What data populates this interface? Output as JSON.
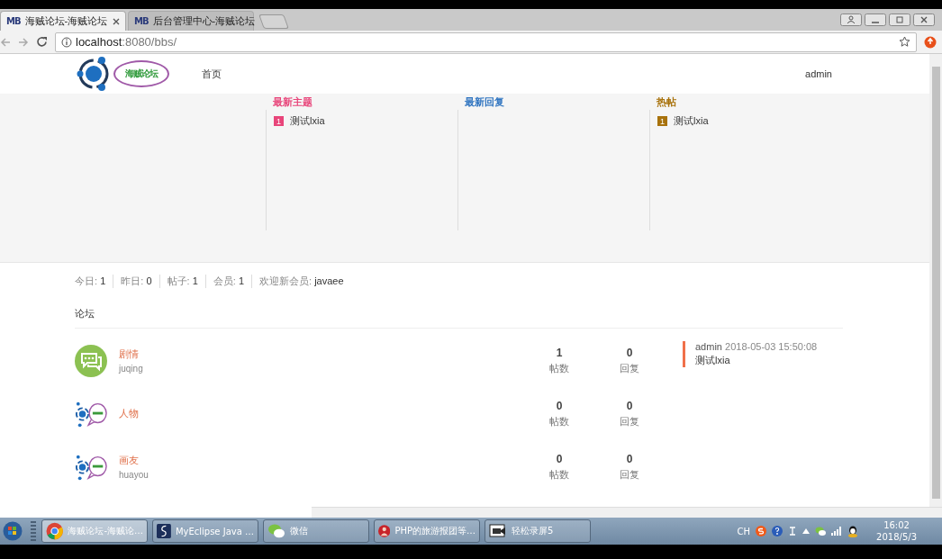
{
  "browser": {
    "tabs": [
      {
        "favicon": "MB",
        "title": "海贼论坛-海贼论坛",
        "selected": true
      },
      {
        "favicon": "MB",
        "title": "后台管理中心-海贼论坛",
        "selected": false
      }
    ],
    "url_host": "localhost",
    "url_path": ":8080/bbs/"
  },
  "header": {
    "logo_text": "海贼论坛",
    "nav": [
      {
        "label": "首页"
      }
    ],
    "user": "admin"
  },
  "panels": [
    {
      "title": "最新主题",
      "color": "#e8457a",
      "items": [
        {
          "rank": "1",
          "title": "测试lxia"
        }
      ]
    },
    {
      "title": "最新回复",
      "color": "#2f74c0"
    },
    {
      "title": "热帖",
      "color": "#a8720c",
      "items": [
        {
          "rank": "1",
          "title": "测试lxia"
        }
      ]
    }
  ],
  "stats": [
    {
      "label": "今日:",
      "value": "1"
    },
    {
      "label": "昨日:",
      "value": "0"
    },
    {
      "label": "帖子:",
      "value": "1"
    },
    {
      "label": "会员:",
      "value": "1"
    },
    {
      "label": "欢迎新会员:",
      "value": "javaee"
    }
  ],
  "section_title": "论坛",
  "forums": [
    {
      "kind": "chat",
      "name": "剧情",
      "slug": "juqing",
      "posts": "1",
      "posts_label": "帖数",
      "replies": "0",
      "replies_label": "回复",
      "last_post": {
        "author": "admin",
        "time": "2018-05-03 15:50:08",
        "title": "测试lxia"
      }
    },
    {
      "kind": "logo",
      "name": "人物",
      "posts": "0",
      "posts_label": "帖数",
      "replies": "0",
      "replies_label": "回复"
    },
    {
      "kind": "logo",
      "name": "画友",
      "slug": "huayou",
      "posts": "0",
      "posts_label": "帖数",
      "replies": "0",
      "replies_label": "回复"
    }
  ],
  "taskbar": {
    "items": [
      {
        "kind": "chrome",
        "label": "海贼论坛-海贼论…",
        "selected": true
      },
      {
        "kind": "eclipse",
        "label": "MyEclipse Java …",
        "selected": false
      },
      {
        "kind": "wechat",
        "label": "微信",
        "selected": false
      },
      {
        "kind": "avatar",
        "label": "PHP的旅游报团等…",
        "selected": false
      },
      {
        "kind": "recorder",
        "label": "轻松录屏5",
        "selected": false
      }
    ],
    "tray": {
      "lang": "CH",
      "time": "16:02",
      "date": "2018/5/3"
    }
  }
}
